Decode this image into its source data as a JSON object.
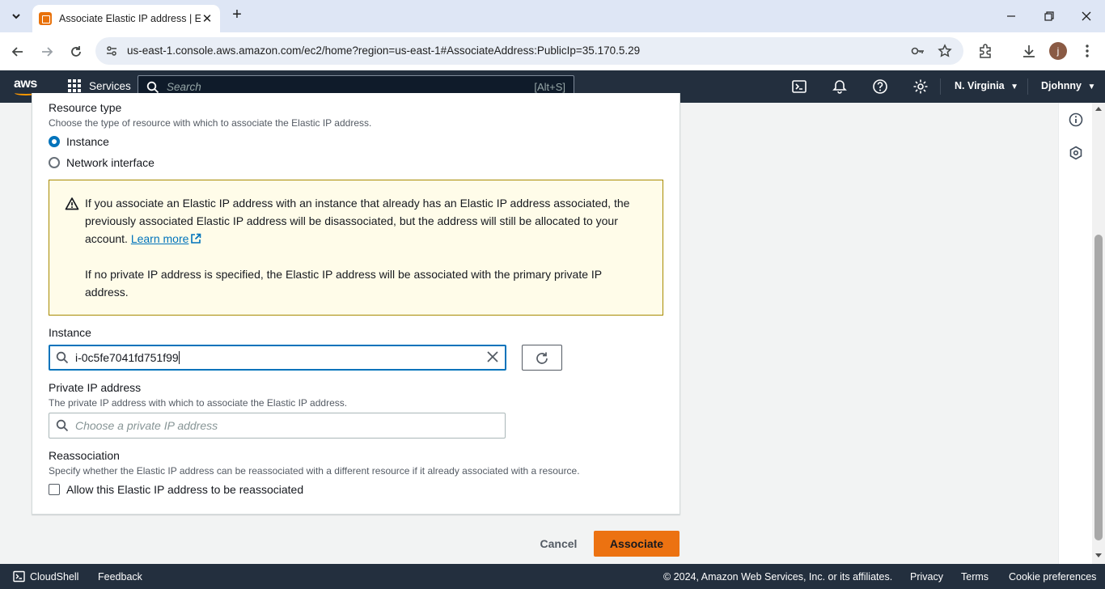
{
  "browser": {
    "tab_title": "Associate Elastic IP address | EC",
    "url": "us-east-1.console.aws.amazon.com/ec2/home?region=us-east-1#AssociateAddress:PublicIp=35.170.5.29",
    "profile_initial": "j"
  },
  "aws_header": {
    "logo": "aws",
    "services_label": "Services",
    "search_placeholder": "Search",
    "search_shortcut": "[Alt+S]",
    "region": "N. Virginia",
    "region_caret": "▼",
    "user": "Djohnny",
    "user_caret": "▼"
  },
  "form": {
    "resource_type_label": "Resource type",
    "resource_type_desc": "Choose the type of resource with which to associate the Elastic IP address.",
    "options": [
      {
        "label": "Instance",
        "selected": true
      },
      {
        "label": "Network interface",
        "selected": false
      }
    ],
    "alert": {
      "line1": "If you associate an Elastic IP address with an instance that already has an Elastic IP address associated, the previously associated Elastic IP address will be disassociated, but the address will still be allocated to your account. ",
      "link": "Learn more",
      "line2": "If no private IP address is specified, the Elastic IP address will be associated with the primary private IP address."
    },
    "instance_label": "Instance",
    "instance_value": "i-0c5fe7041fd751f99",
    "private_ip_label": "Private IP address",
    "private_ip_desc": "The private IP address with which to associate the Elastic IP address.",
    "private_ip_placeholder": "Choose a private IP address",
    "reassoc_label": "Reassociation",
    "reassoc_desc": "Specify whether the Elastic IP address can be reassociated with a different resource if it already associated with a resource.",
    "reassoc_checkbox_label": "Allow this Elastic IP address to be reassociated",
    "reassoc_checked": false
  },
  "actions": {
    "cancel": "Cancel",
    "associate": "Associate"
  },
  "footer": {
    "cloudshell": "CloudShell",
    "feedback": "Feedback",
    "copyright": "© 2024, Amazon Web Services, Inc. or its affiliates.",
    "privacy": "Privacy",
    "terms": "Terms",
    "cookies": "Cookie preferences"
  },
  "colors": {
    "primary_button": "#ec7211",
    "nav_bg": "#232f3e",
    "focus": "#0073bb",
    "alert_bg": "#fffce9",
    "alert_border": "#a78a00"
  }
}
